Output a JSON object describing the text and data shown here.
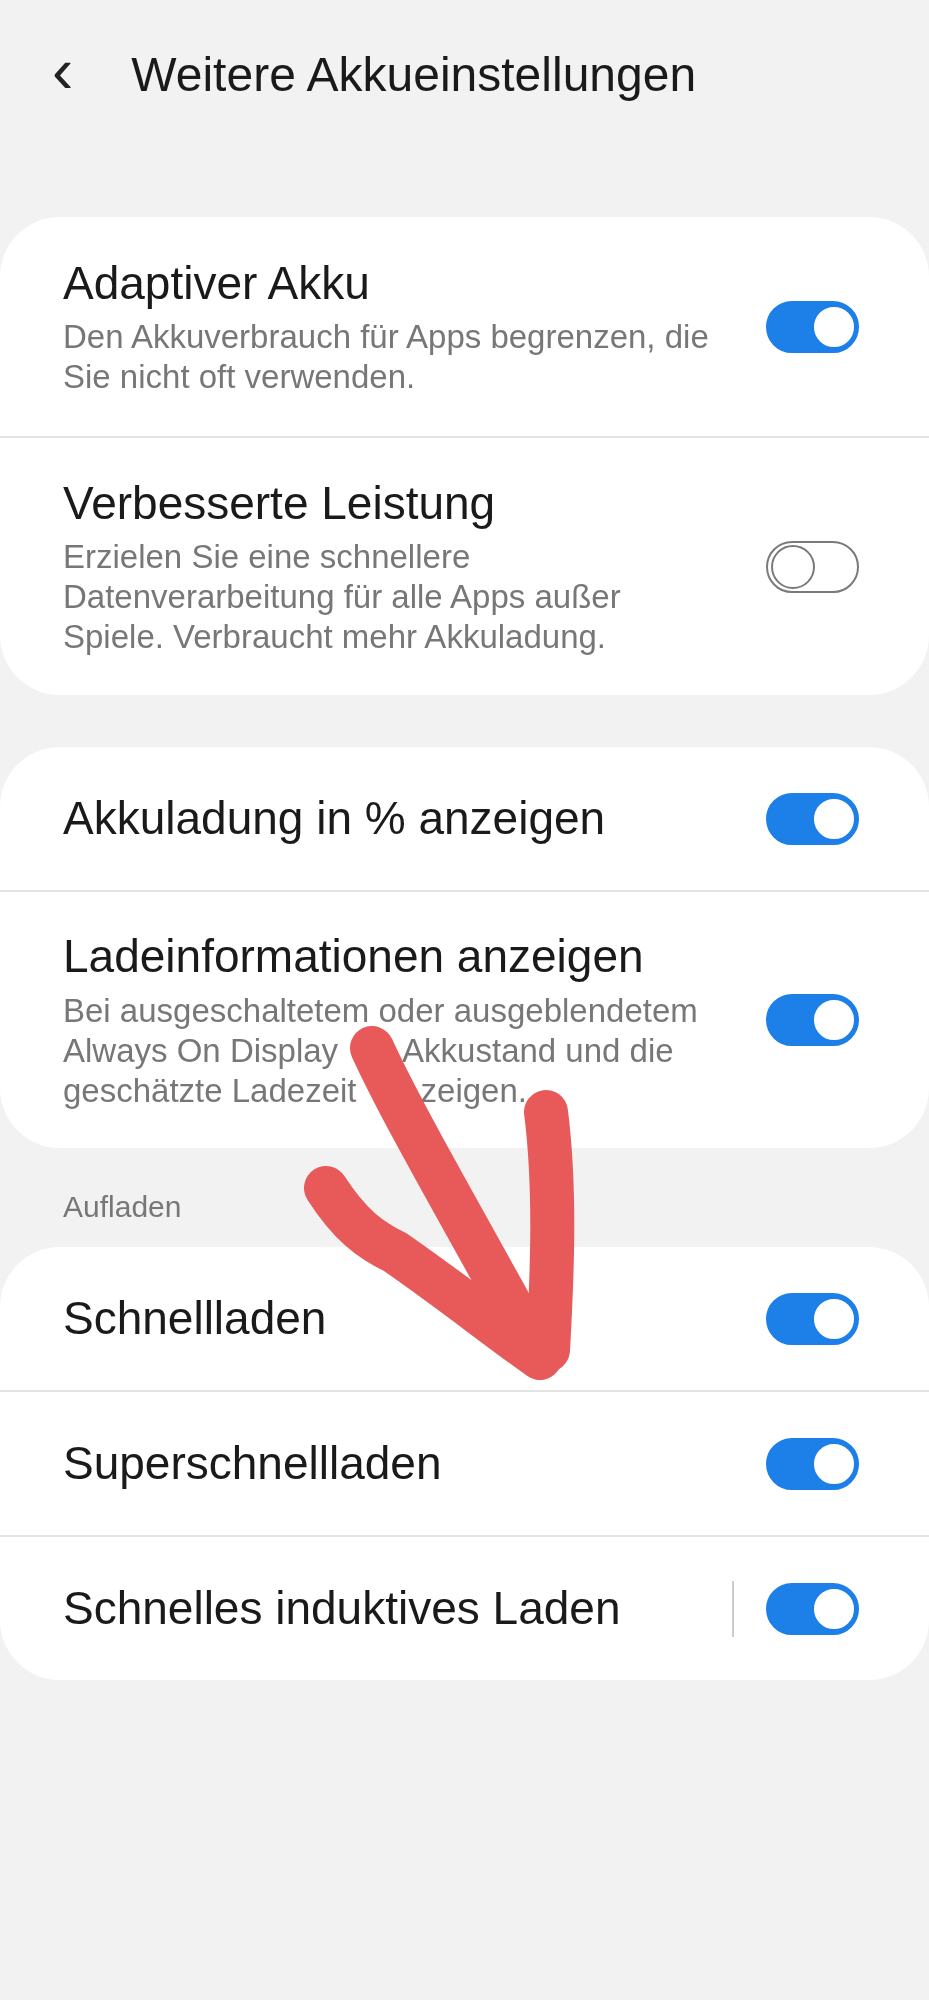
{
  "header": {
    "back": "‹",
    "title": "Weitere Akkueinstellungen"
  },
  "groups": [
    {
      "rows": [
        {
          "title": "Adaptiver Akku",
          "subtitle": "Den Akkuverbrauch für Apps begrenzen, die Sie nicht oft verwenden.",
          "on": true,
          "separator": false
        },
        {
          "title": "Verbesserte Leistung",
          "subtitle": "Erzielen Sie eine schnellere Datenverarbeitung für alle Apps außer Spiele. Verbraucht mehr Akkuladung.",
          "on": false,
          "separator": false
        }
      ]
    },
    {
      "rows": [
        {
          "title": "Akkuladung in % anzeigen",
          "on": true,
          "separator": false
        },
        {
          "title": "Ladeinformationen anzeigen",
          "subtitle": [
            [
              "Bei ausgeschaltetem oder ausgeblendetem"
            ],
            [
              "Always On Display",
              "Akkustand und die"
            ],
            [
              "geschätzte Ladezeit",
              "zeigen."
            ]
          ],
          "on": true,
          "separator": false
        }
      ]
    },
    {
      "heading": "Aufladen",
      "rows": [
        {
          "title": "Schnellladen",
          "on": true,
          "separator": false
        },
        {
          "title": "Superschnellladen",
          "on": true,
          "separator": false
        },
        {
          "title": "Schnelles induktives Laden",
          "on": true,
          "separator": true
        }
      ]
    }
  ],
  "annotation": {
    "kind": "arrow",
    "color": "#e85a5a"
  }
}
